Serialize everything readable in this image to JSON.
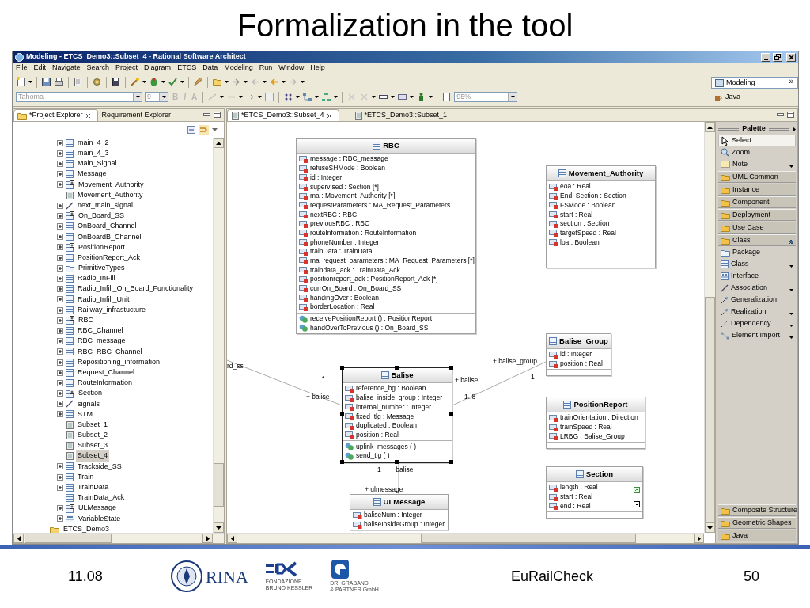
{
  "slide_title": "Formalization in the tool",
  "window": {
    "title": "Modeling - ETCS_Demo3::Subset_4 - Rational Software Architect"
  },
  "menu": [
    "File",
    "Edit",
    "Navigate",
    "Search",
    "Project",
    "Diagram",
    "ETCS",
    "Data",
    "Modeling",
    "Run",
    "Window",
    "Help"
  ],
  "format_toolbar": {
    "font": "Tahoma",
    "size": "9",
    "buttons": [
      {
        "label": "B",
        "disabled": true
      },
      {
        "label": "I",
        "disabled": true
      },
      {
        "label": "A",
        "disabled": true
      }
    ],
    "zoom": "95%"
  },
  "perspectives": [
    {
      "label": "Modeling",
      "selected": true
    },
    {
      "label": "Java",
      "selected": false
    }
  ],
  "perspective_more": "»",
  "left_tabs": [
    {
      "label": "*Project Explorer",
      "selected": true
    },
    {
      "label": "Requirement Explorer",
      "selected": false
    }
  ],
  "tree": [
    {
      "children": [
        {
          "label": "main_4_2",
          "kind": "class",
          "expandable": true,
          "selected": false
        },
        {
          "label": "main_4_3",
          "kind": "class",
          "expandable": true,
          "selected": false
        },
        {
          "label": "Main_Signal",
          "kind": "class",
          "expandable": true,
          "selected": false
        },
        {
          "label": "Message",
          "kind": "class",
          "expandable": true,
          "selected": false
        },
        {
          "label": "Movement_Authority",
          "kind": "class-plus",
          "expandable": true,
          "selected": false
        },
        {
          "label": "Movement_Authority",
          "kind": "diagram",
          "expandable": false,
          "selected": false
        },
        {
          "label": "next_main_signal",
          "kind": "association",
          "expandable": true,
          "selected": false
        },
        {
          "label": "On_Board_SS",
          "kind": "class-plus",
          "expandable": true,
          "selected": false
        },
        {
          "label": "OnBoard_Channel",
          "kind": "class",
          "expandable": true,
          "selected": false
        },
        {
          "label": "OnBoardB_Channel",
          "kind": "class",
          "expandable": true,
          "selected": false
        },
        {
          "label": "PositionReport",
          "kind": "class-plus",
          "expandable": true,
          "selected": false
        },
        {
          "label": "PositionReport_Ack",
          "kind": "class",
          "expandable": true,
          "selected": false
        },
        {
          "label": "PrimitiveTypes",
          "kind": "package",
          "expandable": true,
          "selected": false
        },
        {
          "label": "Radio_InFill",
          "kind": "class",
          "expandable": true,
          "selected": false
        },
        {
          "label": "Radio_Infill_On_Board_Functionality",
          "kind": "class",
          "expandable": true,
          "selected": false
        },
        {
          "label": "Radio_Infill_Unit",
          "kind": "class",
          "expandable": true,
          "selected": false
        },
        {
          "label": "Railway_infrastucture",
          "kind": "class",
          "expandable": true,
          "selected": false
        },
        {
          "label": "RBC",
          "kind": "class-plus",
          "expandable": true,
          "selected": false
        },
        {
          "label": "RBC_Channel",
          "kind": "class",
          "expandable": true,
          "selected": false
        },
        {
          "label": "RBC_message",
          "kind": "class",
          "expandable": true,
          "selected": false
        },
        {
          "label": "RBC_RBC_Channel",
          "kind": "class",
          "expandable": true,
          "selected": false
        },
        {
          "label": "Repositioning_information",
          "kind": "class",
          "expandable": true,
          "selected": false
        },
        {
          "label": "Request_Channel",
          "kind": "class",
          "expandable": true,
          "selected": false
        },
        {
          "label": "RouteInformation",
          "kind": "class",
          "expandable": true,
          "selected": false
        },
        {
          "label": "Section",
          "kind": "class-plus",
          "expandable": true,
          "selected": false
        },
        {
          "label": "signals",
          "kind": "association",
          "expandable": true,
          "selected": false
        },
        {
          "label": "STM",
          "kind": "class",
          "expandable": true,
          "selected": false
        },
        {
          "label": "Subset_1",
          "kind": "diagram",
          "expandable": false,
          "selected": false
        },
        {
          "label": "Subset_2",
          "kind": "diagram",
          "expandable": false,
          "selected": false
        },
        {
          "label": "Subset_3",
          "kind": "diagram",
          "expandable": false,
          "selected": false
        },
        {
          "label": "Subset_4",
          "kind": "diagram",
          "expandable": false,
          "selected": true
        },
        {
          "label": "Trackside_SS",
          "kind": "class",
          "expandable": true,
          "selected": false
        },
        {
          "label": "Train",
          "kind": "class",
          "expandable": true,
          "selected": false
        },
        {
          "label": "TrainData",
          "kind": "class",
          "expandable": true,
          "selected": false
        },
        {
          "label": "TrainData_Ack",
          "kind": "class",
          "expandable": false,
          "selected": false
        },
        {
          "label": "ULMessage",
          "kind": "class-plus",
          "expandable": true,
          "selected": false
        },
        {
          "label": "VariableState",
          "kind": "enum",
          "expandable": true,
          "selected": false
        }
      ]
    },
    {
      "label": "ETCS_Demo3",
      "kind": "folder",
      "expandable": false,
      "selected": false
    }
  ],
  "editor_tabs": [
    {
      "label": "*ETCS_Demo3::Subset_4",
      "selected": true
    },
    {
      "label": "*ETCS_Demo3::Subset_1",
      "selected": false
    }
  ],
  "classes": [
    {
      "name": "RBC",
      "selected": false,
      "attributes": [
        "message : RBC_message",
        "refuseSHMode : Boolean",
        "id : Integer",
        "supervised : Section [*]",
        "ma : Movement_Authority [*]",
        "requestParameters : MA_Request_Parameters",
        "nextRBC : RBC",
        "previousRBC : RBC",
        "routeInformation : RouteInformation",
        "phoneNumber : Integer",
        "trainData : TrainData",
        "ma_request_parameters : MA_Request_Parameters [*]",
        "traindata_ack : TrainData_Ack",
        "positionreport_ack : PositionReport_Ack [*]",
        "currOn_Board : On_Board_SS",
        "handingOver : Boolean",
        "borderLocation : Real"
      ],
      "operations": [
        "receivePositionReport () : PositionReport",
        "handOverToPrevious () : On_Board_SS"
      ]
    },
    {
      "name": "Movement_Authority",
      "selected": false,
      "attributes": [
        "eoa : Real",
        "End_Section : Section",
        "FSMode : Boolean",
        "start : Real",
        "section : Section",
        "targetSpeed : Real",
        "loa : Boolean"
      ]
    },
    {
      "name": "Balise_Group",
      "selected": false,
      "attributes": [
        "id : Integer",
        "position : Real"
      ]
    },
    {
      "name": "Balise",
      "selected": true,
      "attributes": [
        "reference_bg : Boolean",
        "balise_inside_group : Integer",
        "internal_number : Integer",
        "fixed_tlg : Message",
        "duplicated : Boolean",
        "position : Real"
      ],
      "operations": [
        "uplink_messages ( )",
        "send_tlg ( )"
      ]
    },
    {
      "name": "PositionReport",
      "selected": false,
      "attributes": [
        "trainOrientation : Direction",
        "trainSpeed : Real",
        "LRBG : Balise_Group"
      ]
    },
    {
      "name": "Section",
      "selected": false,
      "attributes": [
        "length : Real",
        "start : Real",
        "end : Real"
      ]
    },
    {
      "name": "ULMessage",
      "selected": false,
      "attributes": [
        "baliseNum : Integer",
        "baliseInsideGroup : Integer"
      ]
    }
  ],
  "edge_labels": [
    "rd_ss",
    "*",
    "+ balise",
    "+ balise",
    "1..8",
    "+ balise_group",
    "1",
    "1",
    "+ balise",
    "+ ulmessage"
  ],
  "palette": {
    "title": "Palette",
    "items": [
      {
        "label": "Select",
        "kind": "tool",
        "selected": true,
        "dropdown": false,
        "pinned": false
      },
      {
        "label": "Zoom",
        "kind": "tool",
        "selected": false,
        "dropdown": false,
        "pinned": false
      },
      {
        "label": "Note",
        "kind": "tool",
        "selected": false,
        "dropdown": true,
        "pinned": false
      },
      {
        "label": "UML Common",
        "kind": "drawer",
        "selected": false,
        "dropdown": false,
        "pinned": false
      },
      {
        "label": "Instance",
        "kind": "drawer",
        "selected": false,
        "dropdown": false,
        "pinned": false
      },
      {
        "label": "Component",
        "kind": "drawer",
        "selected": false,
        "dropdown": false,
        "pinned": false
      },
      {
        "label": "Deployment",
        "kind": "drawer",
        "selected": false,
        "dropdown": false,
        "pinned": false
      },
      {
        "label": "Use Case",
        "kind": "drawer",
        "selected": false,
        "dropdown": false,
        "pinned": false
      },
      {
        "label": "Class",
        "kind": "drawer",
        "selected": false,
        "dropdown": false,
        "pinned": true
      },
      {
        "label": "Package",
        "kind": "package",
        "selected": false,
        "dropdown": false,
        "pinned": false
      },
      {
        "label": "Class",
        "kind": "class",
        "selected": false,
        "dropdown": true,
        "pinned": false
      },
      {
        "label": "Interface",
        "kind": "interface",
        "selected": false,
        "dropdown": false,
        "pinned": false
      },
      {
        "label": "Association",
        "kind": "association",
        "selected": false,
        "dropdown": true,
        "pinned": false
      },
      {
        "label": "Generalization",
        "kind": "generalization",
        "selected": false,
        "dropdown": false,
        "pinned": false
      },
      {
        "label": "Realization",
        "kind": "realization",
        "selected": false,
        "dropdown": true,
        "pinned": false
      },
      {
        "label": "Dependency",
        "kind": "dependency",
        "selected": false,
        "dropdown": true,
        "pinned": false
      },
      {
        "label": "Element Import",
        "kind": "import",
        "selected": false,
        "dropdown": true,
        "pinned": false
      }
    ],
    "bottom_drawers": [
      "Composite Structure",
      "Geometric Shapes",
      "Java"
    ]
  },
  "footer": {
    "date": "11.08",
    "logos": [
      {
        "kind": "rina",
        "lines": [
          "RINA"
        ]
      },
      {
        "kind": "fbk",
        "lines": [
          "FONDAZIONE",
          "BRUNO KESSLER"
        ]
      },
      {
        "kind": "graband",
        "lines": [
          "DR. GRABAND",
          "& PARTNER GmbH"
        ]
      }
    ],
    "project": "EuRailCheck",
    "page": "50"
  }
}
